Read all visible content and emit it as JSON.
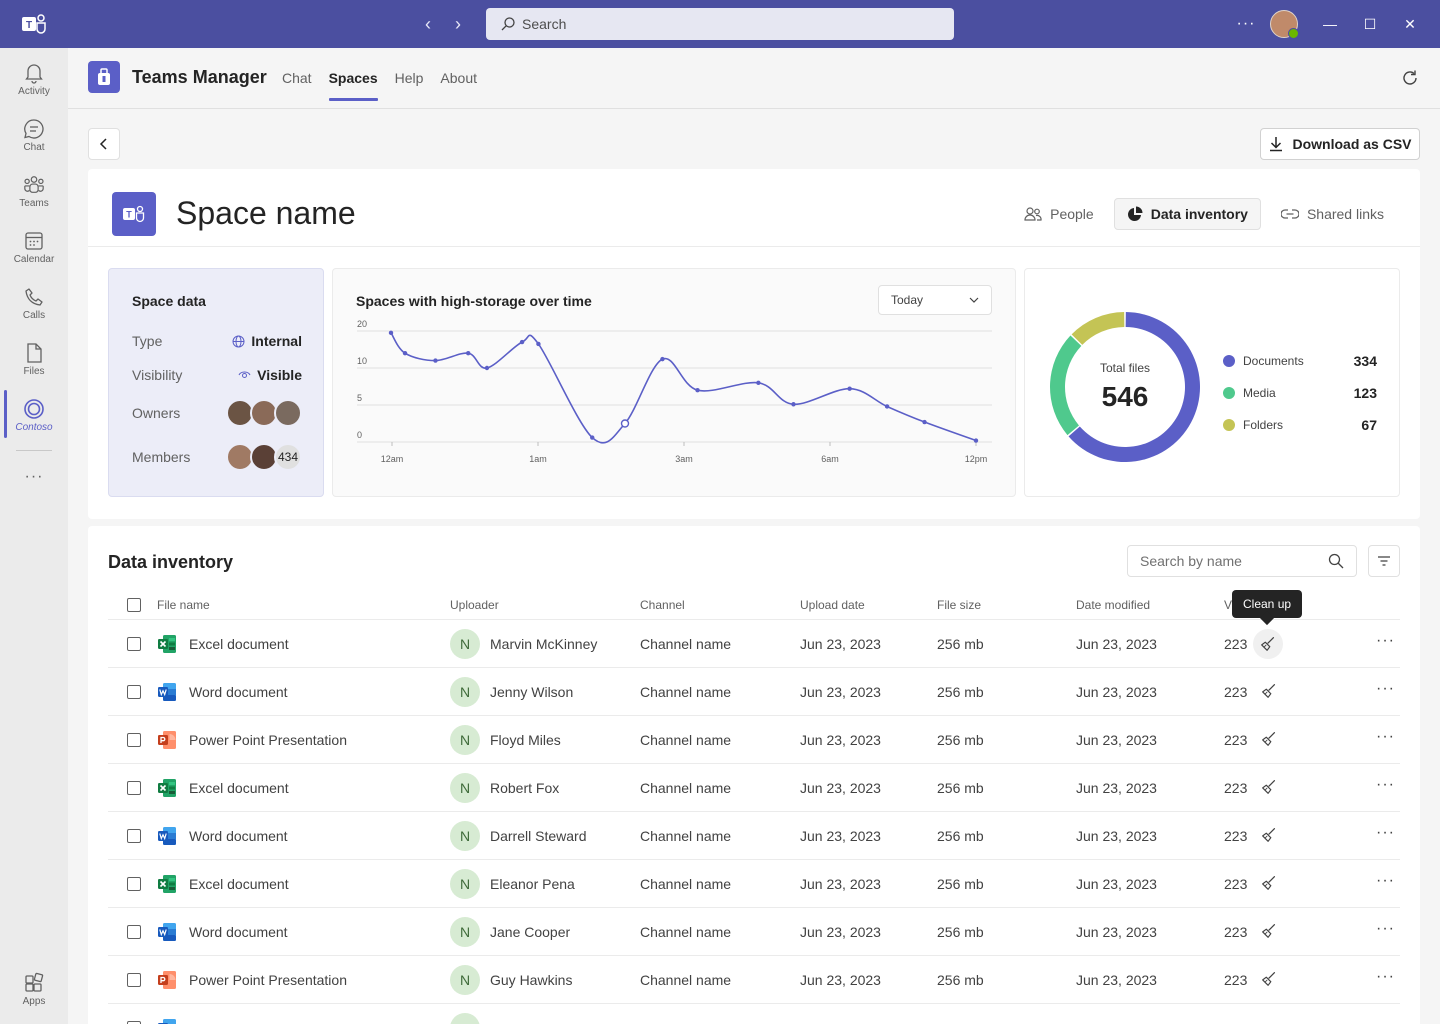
{
  "titlebar": {
    "search_placeholder": "Search",
    "more_label": "···",
    "minimize": "—",
    "maximize": "☐",
    "close": "✕"
  },
  "rail": {
    "items": [
      {
        "label": "Activity",
        "icon": "bell-icon"
      },
      {
        "label": "Chat",
        "icon": "chat-icon"
      },
      {
        "label": "Teams",
        "icon": "teams-icon"
      },
      {
        "label": "Calendar",
        "icon": "calendar-icon"
      },
      {
        "label": "Calls",
        "icon": "phone-icon"
      },
      {
        "label": "Files",
        "icon": "file-icon"
      },
      {
        "label": "Contoso",
        "icon": "contoso-icon",
        "active": true
      }
    ],
    "more": "···",
    "apps_label": "Apps"
  },
  "app": {
    "name": "Teams Manager",
    "tabs": [
      "Chat",
      "Spaces",
      "Help",
      "About"
    ],
    "active_tab": "Spaces"
  },
  "toolbar": {
    "download_label": "Download as CSV"
  },
  "space": {
    "title": "Space name",
    "tabs": [
      {
        "label": "People",
        "icon": "people-icon"
      },
      {
        "label": "Data inventory",
        "icon": "pie-chart-icon",
        "active": true
      },
      {
        "label": "Shared links",
        "icon": "link-icon"
      }
    ]
  },
  "space_data": {
    "title": "Space data",
    "type_label": "Type",
    "type_value": "Internal",
    "visibility_label": "Visibility",
    "visibility_value": "Visible",
    "owners_label": "Owners",
    "members_label": "Members",
    "members_count": "434"
  },
  "chart": {
    "title": "Spaces with high-storage over time",
    "range_value": "Today"
  },
  "chart_data": {
    "type": "line",
    "title": "Spaces with high-storage over time",
    "x_tick_labels": [
      "12am",
      "1am",
      "3am",
      "6am",
      "12pm"
    ],
    "y_tick_labels": [
      "0",
      "5",
      "10",
      "20"
    ],
    "x": [
      0,
      0.6,
      1.9,
      3.3,
      4.1,
      5.6,
      6.3,
      8.6,
      10,
      11.6,
      13.1,
      15.7,
      17.2,
      19.6,
      21.2,
      22.8,
      25
    ],
    "values": [
      19.5,
      14,
      12,
      14,
      10,
      17,
      16.5,
      0.6,
      2.5,
      12.4,
      7,
      8,
      5.1,
      7.2,
      4.8,
      2.7,
      0.2
    ],
    "ylim": [
      0,
      20
    ],
    "color": "#5b5fc7",
    "grid": true
  },
  "donut": {
    "center_label": "Total files",
    "center_value": "546",
    "items": [
      {
        "name": "Documents",
        "value": 334,
        "color": "#5b5fc7"
      },
      {
        "name": "Media",
        "value": 123,
        "color": "#4fc98d"
      },
      {
        "name": "Folders",
        "value": 67,
        "color": "#c4c455"
      }
    ]
  },
  "inventory": {
    "title": "Data inventory",
    "search_placeholder": "Search by name",
    "columns": [
      "File name",
      "Uploader",
      "Channel",
      "Upload date",
      "File size",
      "Date modified",
      "V"
    ],
    "tooltip": "Clean up",
    "rows": [
      {
        "type": "excel",
        "file": "Excel document",
        "initial": "N",
        "uploader": "Marvin McKinney",
        "channel": "Channel name",
        "upload_date": "Jun 23, 2023",
        "size": "256 mb",
        "modified": "Jun 23, 2023",
        "views": "223"
      },
      {
        "type": "word",
        "file": "Word document",
        "initial": "N",
        "uploader": "Jenny Wilson",
        "channel": "Channel name",
        "upload_date": "Jun 23, 2023",
        "size": "256 mb",
        "modified": "Jun 23, 2023",
        "views": "223"
      },
      {
        "type": "ppt",
        "file": "Power Point Presentation",
        "initial": "N",
        "uploader": "Floyd Miles",
        "channel": "Channel name",
        "upload_date": "Jun 23, 2023",
        "size": "256 mb",
        "modified": "Jun 23, 2023",
        "views": "223"
      },
      {
        "type": "excel",
        "file": "Excel document",
        "initial": "N",
        "uploader": "Robert Fox",
        "channel": "Channel name",
        "upload_date": "Jun 23, 2023",
        "size": "256 mb",
        "modified": "Jun 23, 2023",
        "views": "223"
      },
      {
        "type": "word",
        "file": "Word document",
        "initial": "N",
        "uploader": "Darrell Steward",
        "channel": "Channel name",
        "upload_date": "Jun 23, 2023",
        "size": "256 mb",
        "modified": "Jun 23, 2023",
        "views": "223"
      },
      {
        "type": "excel",
        "file": "Excel document",
        "initial": "N",
        "uploader": "Eleanor Pena",
        "channel": "Channel name",
        "upload_date": "Jun 23, 2023",
        "size": "256 mb",
        "modified": "Jun 23, 2023",
        "views": "223"
      },
      {
        "type": "word",
        "file": "Word document",
        "initial": "N",
        "uploader": "Jane Cooper",
        "channel": "Channel name",
        "upload_date": "Jun 23, 2023",
        "size": "256 mb",
        "modified": "Jun 23, 2023",
        "views": "223"
      },
      {
        "type": "ppt",
        "file": "Power Point Presentation",
        "initial": "N",
        "uploader": "Guy Hawkins",
        "channel": "Channel name",
        "upload_date": "Jun 23, 2023",
        "size": "256 mb",
        "modified": "Jun 23, 2023",
        "views": "223"
      },
      {
        "type": "word",
        "file": "",
        "initial": "",
        "uploader": "",
        "channel": "",
        "upload_date": "",
        "size": "",
        "modified": "",
        "views": ""
      }
    ],
    "row_more": "···"
  }
}
